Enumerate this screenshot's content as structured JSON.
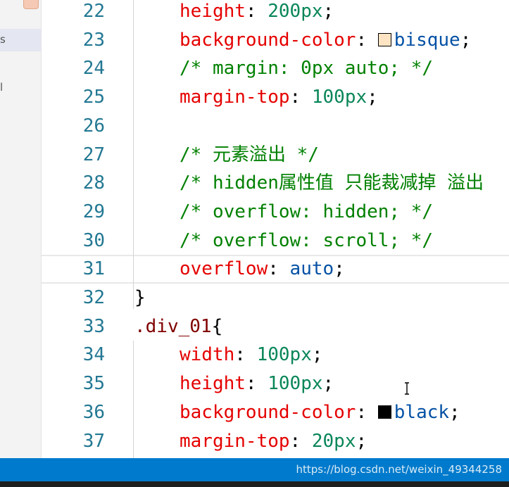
{
  "sidebar": {
    "row1_text": "s",
    "row2_text": "l"
  },
  "editor": {
    "lines": [
      {
        "n": "22",
        "tokens": [
          {
            "t": "height",
            "c": "prop"
          },
          {
            "t": ": ",
            "c": "punc"
          },
          {
            "t": "200px",
            "c": "num"
          },
          {
            "t": ";",
            "c": "punc"
          }
        ]
      },
      {
        "n": "23",
        "tokens": [
          {
            "t": "background-color",
            "c": "prop"
          },
          {
            "t": ": ",
            "c": "punc"
          },
          {
            "swatch": "#ffe4c4"
          },
          {
            "t": "bisque",
            "c": "val"
          },
          {
            "t": ";",
            "c": "punc"
          }
        ]
      },
      {
        "n": "24",
        "tokens": [
          {
            "t": "/* margin: 0px auto; */",
            "c": "com"
          }
        ]
      },
      {
        "n": "25",
        "tokens": [
          {
            "t": "margin-top",
            "c": "prop"
          },
          {
            "t": ": ",
            "c": "punc"
          },
          {
            "t": "100px",
            "c": "num"
          },
          {
            "t": ";",
            "c": "punc"
          }
        ]
      },
      {
        "n": "26",
        "tokens": []
      },
      {
        "n": "27",
        "tokens": [
          {
            "t": "/* 元素溢出 */",
            "c": "com"
          }
        ]
      },
      {
        "n": "28",
        "tokens": [
          {
            "t": "/* hidden属性值 只能裁减掉 溢出",
            "c": "com"
          }
        ]
      },
      {
        "n": "29",
        "tokens": [
          {
            "t": "/* overflow: hidden; */",
            "c": "com"
          }
        ]
      },
      {
        "n": "30",
        "tokens": [
          {
            "t": "/* overflow: scroll; */",
            "c": "com"
          }
        ]
      },
      {
        "n": "31",
        "tokens": [
          {
            "t": "overflow",
            "c": "prop"
          },
          {
            "t": ": ",
            "c": "punc"
          },
          {
            "t": "auto",
            "c": "val"
          },
          {
            "t": ";",
            "c": "punc"
          }
        ],
        "current": true
      },
      {
        "n": "32",
        "tokens": [
          {
            "t": "}",
            "c": "punc"
          }
        ],
        "outdent": true
      },
      {
        "n": "33",
        "tokens": [
          {
            "t": ".div_01",
            "c": "sel"
          },
          {
            "t": "{",
            "c": "punc"
          }
        ],
        "outdent": true
      },
      {
        "n": "34",
        "tokens": [
          {
            "t": "width",
            "c": "prop"
          },
          {
            "t": ": ",
            "c": "punc"
          },
          {
            "t": "100px",
            "c": "num"
          },
          {
            "t": ";",
            "c": "punc"
          }
        ]
      },
      {
        "n": "35",
        "tokens": [
          {
            "t": "height",
            "c": "prop"
          },
          {
            "t": ": ",
            "c": "punc"
          },
          {
            "t": "100px",
            "c": "num"
          },
          {
            "t": ";",
            "c": "punc"
          }
        ]
      },
      {
        "n": "36",
        "tokens": [
          {
            "t": "background-color",
            "c": "prop"
          },
          {
            "t": ": ",
            "c": "punc"
          },
          {
            "swatch": "#000000"
          },
          {
            "t": "black",
            "c": "val"
          },
          {
            "t": ";",
            "c": "punc"
          }
        ]
      },
      {
        "n": "37",
        "tokens": [
          {
            "t": "margin-top",
            "c": "prop"
          },
          {
            "t": ": ",
            "c": "punc"
          },
          {
            "t": "20px",
            "c": "num"
          },
          {
            "t": ";",
            "c": "punc"
          }
        ]
      }
    ]
  },
  "colors": {
    "prop": "#e50000",
    "num": "#098658",
    "val": "#0451a5",
    "com": "#008000",
    "sel": "#800000",
    "linenumber": "#237893",
    "statusbar": "#007acc"
  },
  "statusbar": {
    "watermark": "https://blog.csdn.net/weixin_49344258"
  }
}
